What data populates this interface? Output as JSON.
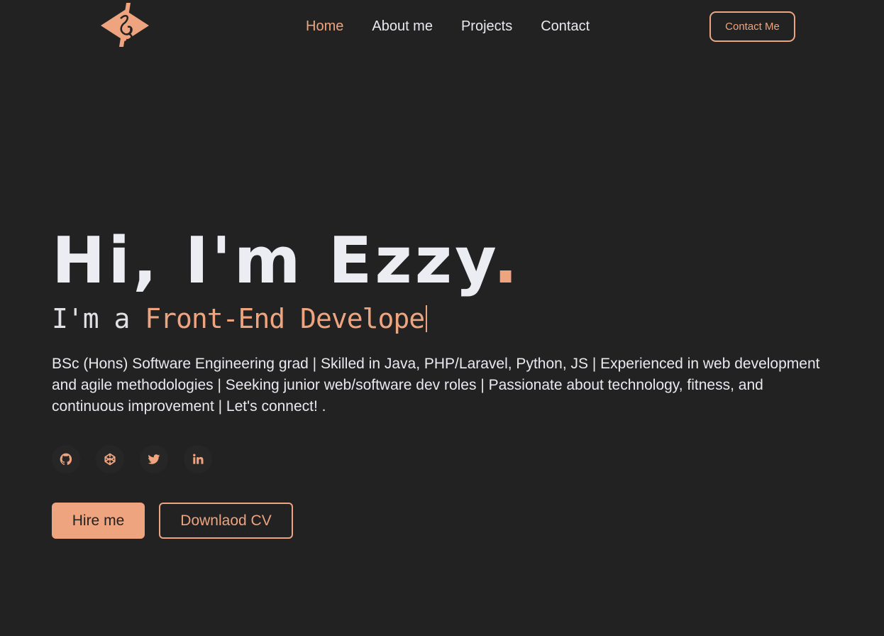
{
  "nav": {
    "links": [
      {
        "label": "Home",
        "active": true
      },
      {
        "label": "About me",
        "active": false
      },
      {
        "label": "Projects",
        "active": false
      },
      {
        "label": "Contact",
        "active": false
      }
    ],
    "contact_button": "Contact Me"
  },
  "hero": {
    "title": "Hi, I'm Ezzy",
    "title_dot": ".",
    "subtitle_prefix": "I'm a ",
    "subtitle_role": "Front-End Develope",
    "description": "BSc (Hons) Software Engineering grad | Skilled in Java, PHP/Laravel, Python, JS | Experienced in web development and agile methodologies | Seeking junior web/software dev roles | Passionate about technology, fitness, and continuous improvement | Let's connect! .",
    "socials": [
      "github-icon",
      "codepen-icon",
      "twitter-icon",
      "linkedin-icon"
    ],
    "hire_button": "Hire me",
    "cv_button": "Downlaod CV"
  },
  "colors": {
    "accent": "#eea47f",
    "background": "#222222",
    "text": "#e9e9f0"
  }
}
